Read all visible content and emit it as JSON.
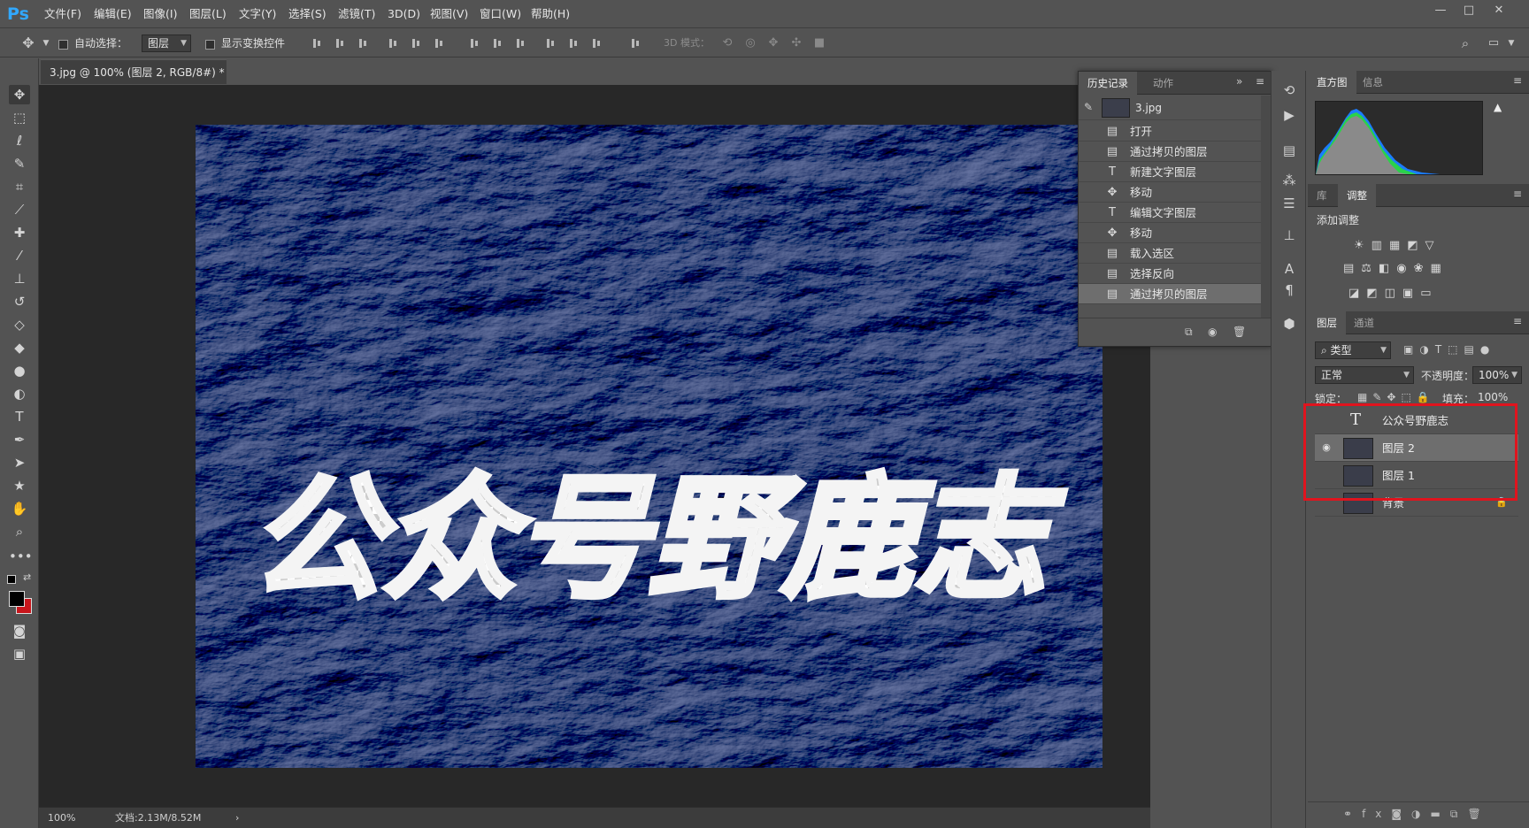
{
  "app": {
    "logo": "Ps",
    "menu": [
      "文件(F)",
      "编辑(E)",
      "图像(I)",
      "图层(L)",
      "文字(Y)",
      "选择(S)",
      "滤镜(T)",
      "3D(D)",
      "视图(V)",
      "窗口(W)",
      "帮助(H)"
    ],
    "window_controls": [
      "—",
      "□",
      "✕"
    ]
  },
  "options": {
    "auto_select_label": "自动选择：",
    "auto_select_value": "图层",
    "show_transform_label": "显示变换控件",
    "mode3d_label": "3D 模式："
  },
  "document": {
    "tab_title": "3.jpg @ 100% (图层 2, RGB/8#) *",
    "zoom": "100%",
    "doc_size": "文档:2.13M/8.52M",
    "watermark_text": "公众号野鹿志"
  },
  "history": {
    "tabs": [
      "历史记录",
      "动作"
    ],
    "snapshot": "3.jpg",
    "items": [
      {
        "label": "打开",
        "icon": "document-icon"
      },
      {
        "label": "通过拷贝的图层",
        "icon": "document-icon"
      },
      {
        "label": "新建文字图层",
        "icon": "text-icon"
      },
      {
        "label": "移动",
        "icon": "move-icon"
      },
      {
        "label": "编辑文字图层",
        "icon": "text-icon"
      },
      {
        "label": "移动",
        "icon": "move-icon"
      },
      {
        "label": "载入选区",
        "icon": "document-icon"
      },
      {
        "label": "选择反向",
        "icon": "document-icon"
      },
      {
        "label": "通过拷贝的图层",
        "icon": "document-icon"
      }
    ],
    "selected_index": 8
  },
  "histogram": {
    "tabs": [
      "直方图",
      "信息"
    ]
  },
  "adjustments": {
    "tabs": [
      "库",
      "调整"
    ],
    "add_label": "添加调整"
  },
  "layers": {
    "tabs": [
      "图层",
      "通道"
    ],
    "filter_label": "类型",
    "blend_mode": "正常",
    "opacity_label": "不透明度：",
    "opacity_value": "100%",
    "lock_label": "锁定：",
    "fill_label": "填充：",
    "fill_value": "100%",
    "items": [
      {
        "name": "公众号野鹿志",
        "type": "text",
        "visible": false
      },
      {
        "name": "图层 2",
        "type": "pixel",
        "visible": true,
        "selected": true
      },
      {
        "name": "图层 1",
        "type": "pixel",
        "visible": false
      },
      {
        "name": "背景",
        "type": "pixel",
        "visible": false,
        "locked": true
      }
    ]
  },
  "colors": {
    "foreground": "#000000",
    "background": "#c8161c",
    "highlight": "#e0141e",
    "brand": "#31a8ff"
  }
}
